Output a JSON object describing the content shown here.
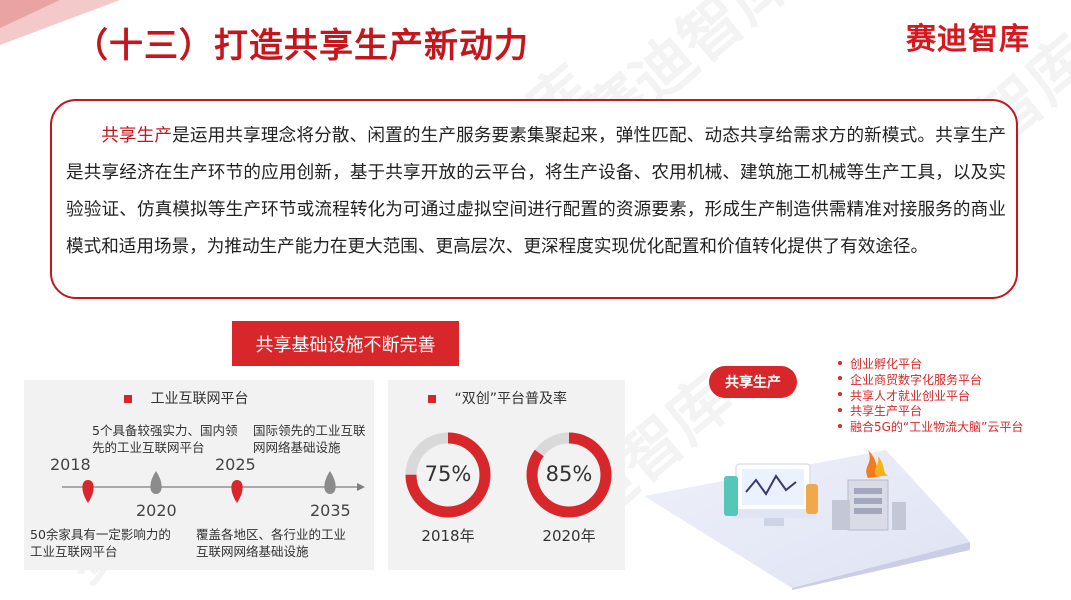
{
  "title": "（十三）打造共享生产新动力",
  "brand": "赛迪智库",
  "intro": {
    "highlight": "共享生产",
    "text": "是运用共享理念将分散、闲置的生产服务要素集聚起来，弹性匹配、动态共享给需求方的新模式。共享生产是共享经济在生产环节的应用创新，基于共享开放的云平台，将生产设备、农用机械、建筑施工机械等生产工具，以及实验验证、仿真模拟等生产环节或流程转化为可通过虚拟空间进行配置的资源要素，形成生产制造供需精准对接服务的商业模式和适用场景，为推动生产能力在更大范围、更高层次、更深程度实现优化配置和价值转化提供了有效途径。"
  },
  "banner": "共享基础设施不断完善",
  "industrial_panel": {
    "title": "工业互联网平台",
    "timeline": [
      {
        "year": "2018",
        "note": "50余家具有一定影响力的工业互联网平台",
        "highlight": true
      },
      {
        "year": "2020",
        "note": "5个具备较强实力、国内领先的工业互联网平台",
        "highlight": false
      },
      {
        "year": "2025",
        "note": "覆盖各地区、各行业的工业互联网网络基础设施",
        "highlight": true
      },
      {
        "year": "2035",
        "note": "国际领先的工业互联网网络基础设施",
        "highlight": false
      }
    ]
  },
  "shuangchuang_panel": {
    "title": "“双创”平台普及率",
    "items": [
      {
        "value": 75,
        "label": "75%",
        "year": "2018年"
      },
      {
        "value": 85,
        "label": "85%",
        "year": "2020年"
      }
    ]
  },
  "shared_production": {
    "label": "共享生产",
    "items": [
      "创业孵化平台",
      "企业商贸数字化服务平台",
      "共享人才就业创业平台",
      "共享生产平台",
      "融合5G的“工业物流大脑”云平台"
    ]
  },
  "colors": {
    "accent": "#d7272a",
    "title": "#c4161c",
    "panel": "#f2f2f2",
    "ring_track": "#d9d9d9"
  }
}
